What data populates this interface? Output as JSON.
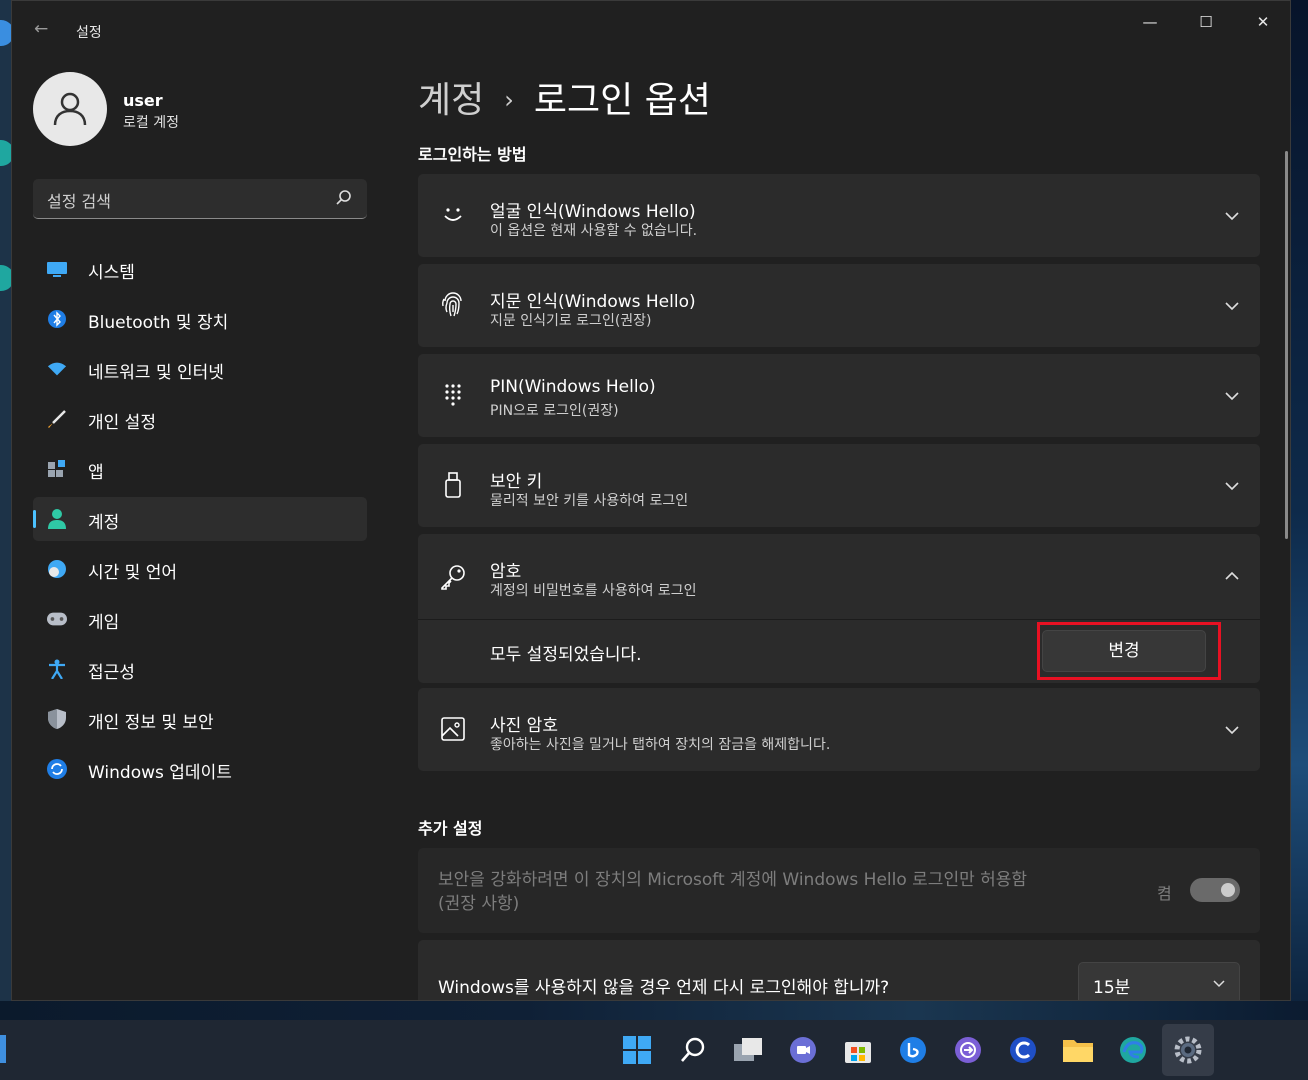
{
  "window": {
    "app_title": "설정"
  },
  "user": {
    "name": "user",
    "type": "로컬 계정"
  },
  "search": {
    "placeholder": "설정 검색"
  },
  "sidebar": {
    "items": [
      {
        "label": "시스템"
      },
      {
        "label": "Bluetooth 및 장치"
      },
      {
        "label": "네트워크 및 인터넷"
      },
      {
        "label": "개인 설정"
      },
      {
        "label": "앱"
      },
      {
        "label": "계정",
        "selected": true
      },
      {
        "label": "시간 및 언어"
      },
      {
        "label": "게임"
      },
      {
        "label": "접근성"
      },
      {
        "label": "개인 정보 및 보안"
      },
      {
        "label": "Windows 업데이트"
      }
    ]
  },
  "breadcrumb": {
    "parent": "계정",
    "separator": "›",
    "current": "로그인 옵션"
  },
  "sections": {
    "signin_methods": "로그인하는 방법",
    "additional": "추가 설정"
  },
  "methods": [
    {
      "title": "얼굴 인식(Windows Hello)",
      "subtitle": "이 옵션은 현재 사용할 수 없습니다.",
      "icon": "face-icon"
    },
    {
      "title": "지문 인식(Windows Hello)",
      "subtitle": "지문 인식기로 로그인(권장)",
      "icon": "fingerprint-icon"
    },
    {
      "title": "PIN(Windows Hello)",
      "subtitle": "PIN으로 로그인(권장)",
      "icon": "keypad-icon"
    },
    {
      "title": "보안 키",
      "subtitle": "물리적 보안 키를 사용하여 로그인",
      "icon": "usb-key-icon"
    },
    {
      "title": "암호",
      "subtitle": "계정의 비밀번호를 사용하여 로그인",
      "icon": "key-icon",
      "expanded": true
    },
    {
      "title": "사진 암호",
      "subtitle": "좋아하는 사진을 밀거나 탭하여 장치의 잠금을 해제합니다.",
      "icon": "picture-icon"
    }
  ],
  "password_expanded": {
    "status": "모두 설정되었습니다.",
    "change_button": "변경"
  },
  "additional_settings": {
    "hello_only_text": "보안을 강화하려면 이 장치의 Microsoft 계정에 Windows Hello 로그인만 허용함 (권장 사항)",
    "hello_only_state": "켬",
    "relogin_question": "Windows를 사용하지 않을 경우 언제 다시 로그인해야 합니까?",
    "relogin_value": "15분"
  },
  "taskbar": {
    "items": [
      "start-icon",
      "search-icon",
      "task-view-icon",
      "teams-chat-icon",
      "store-icon",
      "bing-icon",
      "app-circle-icon",
      "app-c-icon",
      "file-explorer-icon",
      "edge-icon",
      "settings-icon"
    ]
  },
  "colors": {
    "accent": "#4cc2ff",
    "highlight": "#e81123"
  }
}
